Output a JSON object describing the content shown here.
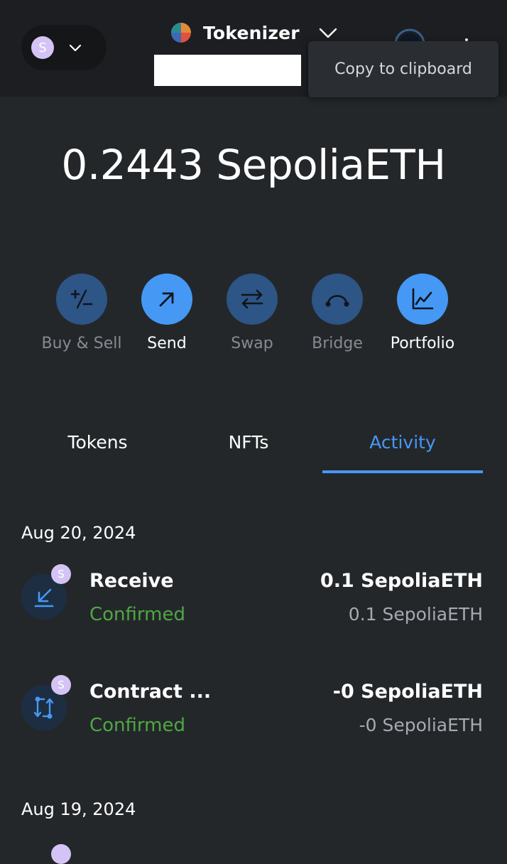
{
  "header": {
    "network_badge_letter": "S",
    "account_name": "Tokenizer",
    "tooltip": "Copy to clipboard"
  },
  "balance": {
    "amount": "0.2443",
    "unit": "SepoliaETH"
  },
  "actions": [
    {
      "label": "Buy & Sell",
      "icon": "plus-minus-icon",
      "enabled": false
    },
    {
      "label": "Send",
      "icon": "arrow-up-right-icon",
      "enabled": true
    },
    {
      "label": "Swap",
      "icon": "swap-arrows-icon",
      "enabled": false
    },
    {
      "label": "Bridge",
      "icon": "bridge-icon",
      "enabled": false
    },
    {
      "label": "Portfolio",
      "icon": "chart-line-icon",
      "enabled": true
    }
  ],
  "tabs": [
    {
      "label": "Tokens",
      "active": false
    },
    {
      "label": "NFTs",
      "active": false
    },
    {
      "label": "Activity",
      "active": true
    }
  ],
  "activity": [
    {
      "date": "Aug 20, 2024",
      "transactions": [
        {
          "title": "Receive",
          "status": "Confirmed",
          "amount": "0.1 SepoliaETH",
          "sub_amount": "0.1 SepoliaETH",
          "icon": "receive-arrow-icon",
          "badge": "S"
        },
        {
          "title": "Contract ...",
          "status": "Confirmed",
          "amount": "-0 SepoliaETH",
          "sub_amount": "-0 SepoliaETH",
          "icon": "contract-interaction-icon",
          "badge": "S"
        }
      ]
    },
    {
      "date": "Aug 19, 2024",
      "transactions": []
    }
  ],
  "colors": {
    "background": "#24272a",
    "header": "#1c1e21",
    "accent": "#4599f5",
    "action_dim": "#2d5585",
    "confirmed": "#4ea843",
    "badge": "#d4c4f5"
  }
}
